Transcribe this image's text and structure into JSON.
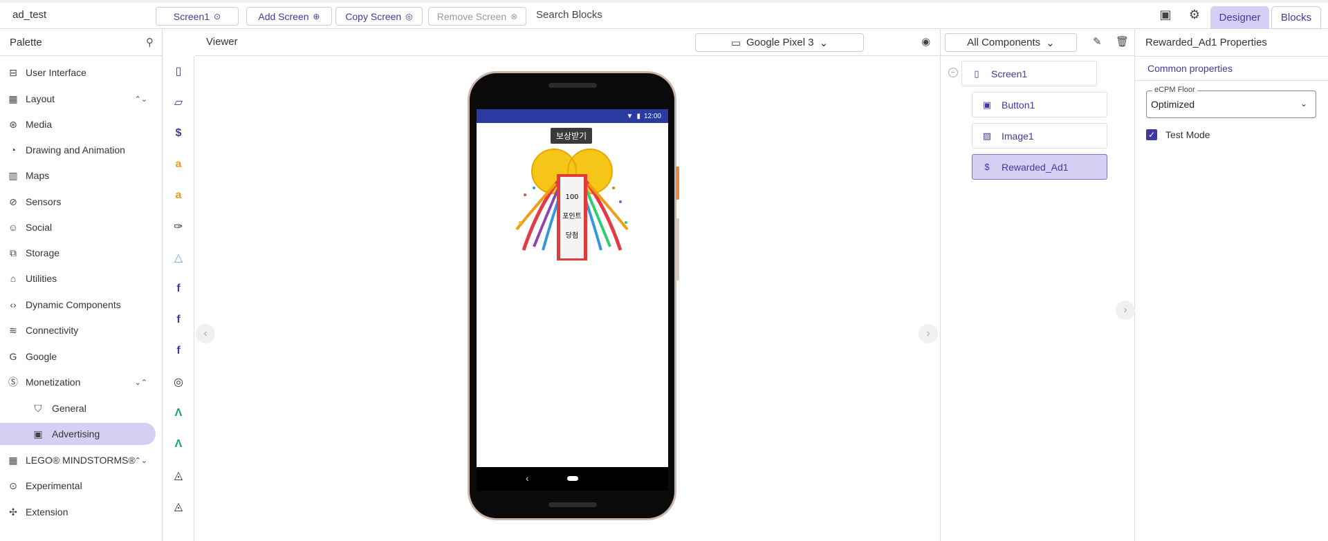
{
  "app": {
    "name": "ad_test"
  },
  "toolbar": {
    "screen_select": "Screen1",
    "add_screen": "Add Screen",
    "copy_screen": "Copy Screen",
    "remove_screen": "Remove Screen",
    "search_blocks": "Search Blocks",
    "designer_tab": "Designer",
    "blocks_tab": "Blocks"
  },
  "palette": {
    "title": "Palette",
    "categories": [
      {
        "label": "User Interface",
        "icon": "user-interface-icon"
      },
      {
        "label": "Layout",
        "icon": "layout-icon"
      },
      {
        "label": "Media",
        "icon": "media-icon"
      },
      {
        "label": "Drawing and Animation",
        "icon": "palette-icon"
      },
      {
        "label": "Maps",
        "icon": "map-icon"
      },
      {
        "label": "Sensors",
        "icon": "sensor-icon"
      },
      {
        "label": "Social",
        "icon": "social-icon"
      },
      {
        "label": "Storage",
        "icon": "storage-icon"
      },
      {
        "label": "Utilities",
        "icon": "briefcase-icon"
      },
      {
        "label": "Dynamic Components",
        "icon": "code-icon"
      },
      {
        "label": "Connectivity",
        "icon": "connectivity-icon"
      },
      {
        "label": "Google",
        "icon": "google-icon"
      },
      {
        "label": "Monetization",
        "icon": "dollar-icon"
      },
      {
        "label": "General",
        "icon": "cart-icon"
      },
      {
        "label": "Advertising",
        "icon": "ad-icon"
      },
      {
        "label": "LEGO® MINDSTORMS®",
        "icon": "lego-icon"
      },
      {
        "label": "Experimental",
        "icon": "experimental-icon"
      },
      {
        "label": "Extension",
        "icon": "extension-icon"
      }
    ]
  },
  "viewer": {
    "title": "Viewer",
    "device": "Google Pixel 3",
    "status_time": "12:00",
    "button1_text": "보상받기"
  },
  "components": {
    "filter": "All Components",
    "tree": [
      "Screen1",
      "Button1",
      "Image1",
      "Rewarded_Ad1"
    ]
  },
  "properties": {
    "title": "Rewarded_Ad1 Properties",
    "section": "Common properties",
    "ecpm_label": "eCPM Floor",
    "ecpm_value": "Optimized",
    "test_mode_label": "Test Mode",
    "test_mode_checked": true
  },
  "colors": {
    "accent": "#3f3aa0",
    "selected_bg": "#d6cff3",
    "status_bar": "#2a3aa0"
  }
}
